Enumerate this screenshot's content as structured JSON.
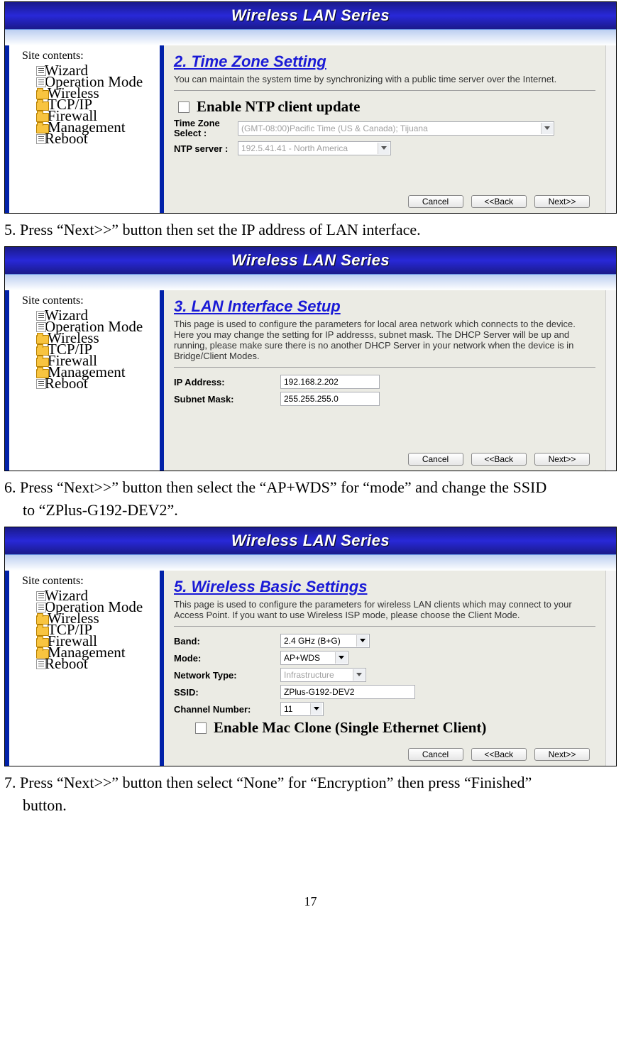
{
  "banner": "Wireless LAN Series",
  "sidebar": {
    "title": "Site contents:",
    "items": [
      {
        "label": "Wizard",
        "icon": "doc"
      },
      {
        "label": "Operation Mode",
        "icon": "doc"
      },
      {
        "label": "Wireless",
        "icon": "folder"
      },
      {
        "label": "TCP/IP",
        "icon": "folder"
      },
      {
        "label": "Firewall",
        "icon": "folder"
      },
      {
        "label": "Management",
        "icon": "folder"
      },
      {
        "label": "Reboot",
        "icon": "doc"
      }
    ]
  },
  "shot1": {
    "title": "2. Time Zone Setting",
    "desc": "You can maintain the system time by synchronizing with a public time server over the Internet.",
    "enable_label": "Enable NTP client update",
    "tz_label": "Time Zone Select :",
    "tz_value": "(GMT-08:00)Pacific Time (US & Canada); Tijuana",
    "ntp_label": "NTP server :",
    "ntp_value": "192.5.41.41 - North America",
    "buttons": {
      "cancel": "Cancel",
      "back": "<<Back",
      "next": "Next>>"
    }
  },
  "step5": "5. Press “Next>>” button then set the IP address of LAN interface.",
  "shot2": {
    "title": "3. LAN Interface Setup",
    "desc": "This page is used to configure the parameters for local area network which connects to the device. Here you may change the setting for IP addresss, subnet mask. The DHCP Server will be up and running, please make sure there is no another DHCP Server in your network when the device is in Bridge/Client Modes.",
    "ip_label": "IP Address:",
    "ip_value": "192.168.2.202",
    "mask_label": "Subnet Mask:",
    "mask_value": "255.255.255.0",
    "buttons": {
      "cancel": "Cancel",
      "back": "<<Back",
      "next": "Next>>"
    }
  },
  "step6": "6. Press “Next>>” button then select the “AP+WDS” for “mode” and change the SSID",
  "step6b": "to “ZPlus-G192-DEV2”.",
  "shot3": {
    "title": "5. Wireless Basic Settings",
    "desc": "This page is used to configure the parameters for wireless LAN clients which may connect to your Access Point. If you want to use Wireless ISP mode, please choose the Client Mode.",
    "band_label": "Band:",
    "band_value": "2.4 GHz (B+G)",
    "mode_label": "Mode:",
    "mode_value": "AP+WDS",
    "nt_label": "Network Type:",
    "nt_value": "Infrastructure",
    "ssid_label": "SSID:",
    "ssid_value": "ZPlus-G192-DEV2",
    "ch_label": "Channel Number:",
    "ch_value": "11",
    "mac_label": "Enable Mac Clone (Single Ethernet Client)",
    "buttons": {
      "cancel": "Cancel",
      "back": "<<Back",
      "next": "Next>>"
    }
  },
  "step7": "7. Press “Next>>” button then select “None” for “Encryption” then press “Finished”",
  "step7b": "button.",
  "pagenum": "17"
}
